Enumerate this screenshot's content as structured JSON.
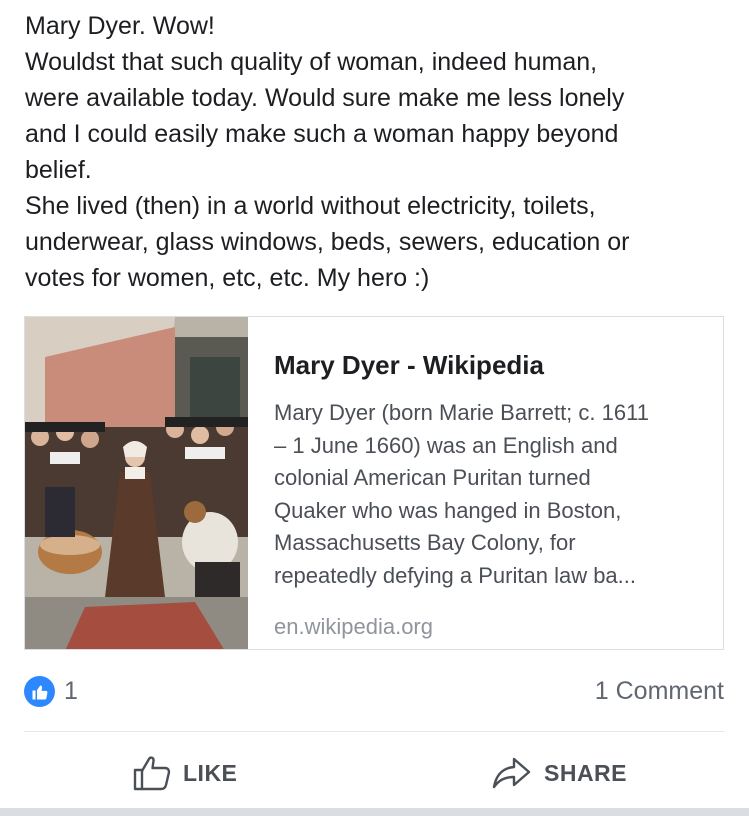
{
  "post": {
    "text_lines": [
      "Mary Dyer. Wow!",
      "Wouldst that such quality of woman, indeed human,",
      "were available today. Would sure make me less lonely",
      "and I could easily make such a woman happy beyond",
      "belief.",
      "She lived (then) in a world without electricity, toilets,",
      "underwear, glass windows, beds, sewers, education or",
      "votes for women, etc, etc. My hero :)"
    ]
  },
  "link_preview": {
    "title": "Mary Dyer - Wikipedia",
    "description_lines": [
      "Mary Dyer (born Marie Barrett; c. 1611",
      "– 1 June 1660) was an English and",
      "colonial American Puritan turned",
      "Quaker who was hanged in Boston,",
      "Massachusetts Bay Colony, for",
      "repeatedly defying a Puritan law ba..."
    ],
    "domain": "en.wikipedia.org",
    "thumbnail_icon": "painting-thumbnail"
  },
  "reactions": {
    "like_count": "1",
    "comment_count": "1 Comment",
    "like_badge_color": "#2d88ff"
  },
  "actions": {
    "like_label": "LIKE",
    "share_label": "SHARE"
  }
}
